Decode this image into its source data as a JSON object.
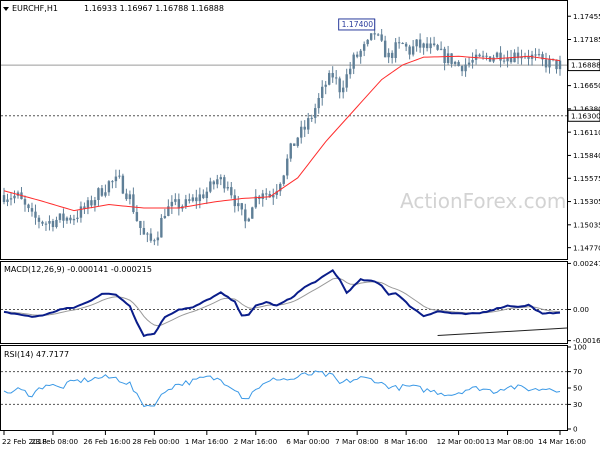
{
  "header": {
    "symbol": "EURCHF,H1",
    "ohlc": "1.16933 1.16967 1.16788 1.16888"
  },
  "watermark": "ActionForex.com",
  "colors": {
    "candle": "#5f7f97",
    "ma": "#ff2d2d",
    "macd": "#0a1d8a",
    "signal": "#9a9a9a",
    "rsi": "#3b99e6",
    "level": "#555555",
    "grid": "#c8c8c8",
    "frame": "#000000",
    "watermark": "#d3d3d3",
    "diverge": "#202020"
  },
  "chart_data": [
    {
      "id": "price",
      "type": "candlestick",
      "symbol": "EURCHF",
      "timeframe": "H1",
      "title": "EURCHF,H1  1.16933 1.16967 1.16788 1.16888",
      "ylim": [
        1.1465,
        1.1762
      ],
      "yticks": [
        "1.17455",
        "1.17185",
        "1.16915",
        "1.16650",
        "1.16380",
        "1.16110",
        "1.15840",
        "1.15575",
        "1.15305",
        "1.15035",
        "1.14770"
      ],
      "x_tick_labels": [
        "22 Feb 2018",
        "23 Feb 08:00",
        "26 Feb 16:00",
        "28 Feb 00:00",
        "1 Mar 16:00",
        "2 Mar 16:00",
        "6 Mar 00:00",
        "7 Mar 08:00",
        "8 Mar 16:00",
        "12 Mar 00:00",
        "13 Mar 08:00",
        "14 Mar 16:00"
      ],
      "x_tick_index": [
        0,
        14,
        29,
        43,
        58,
        72,
        87,
        101,
        115,
        130,
        144,
        159
      ],
      "close_label": "1.16888",
      "level_label": "1.16300",
      "level_value": 1.163,
      "peak_label": "1.17400",
      "peak_index": 106,
      "anchors": [
        [
          0,
          1.1538
        ],
        [
          4,
          1.1536
        ],
        [
          8,
          1.1512
        ],
        [
          12,
          1.1506
        ],
        [
          16,
          1.151
        ],
        [
          20,
          1.1513
        ],
        [
          24,
          1.1525
        ],
        [
          27,
          1.154
        ],
        [
          30,
          1.1552
        ],
        [
          33,
          1.1554
        ],
        [
          36,
          1.1535
        ],
        [
          38,
          1.151
        ],
        [
          40,
          1.149
        ],
        [
          42,
          1.1484
        ],
        [
          44,
          1.1496
        ],
        [
          46,
          1.152
        ],
        [
          49,
          1.1526
        ],
        [
          52,
          1.1527
        ],
        [
          55,
          1.1534
        ],
        [
          58,
          1.1542
        ],
        [
          61,
          1.1556
        ],
        [
          64,
          1.1552
        ],
        [
          67,
          1.1522
        ],
        [
          69,
          1.1506
        ],
        [
          71,
          1.153
        ],
        [
          74,
          1.1544
        ],
        [
          76,
          1.1537
        ],
        [
          78,
          1.1548
        ],
        [
          80,
          1.1566
        ],
        [
          82,
          1.159
        ],
        [
          84,
          1.1606
        ],
        [
          86,
          1.1615
        ],
        [
          88,
          1.163
        ],
        [
          90,
          1.1648
        ],
        [
          92,
          1.1667
        ],
        [
          94,
          1.1677
        ],
        [
          96,
          1.1662
        ],
        [
          98,
          1.1676
        ],
        [
          100,
          1.1695
        ],
        [
          102,
          1.1704
        ],
        [
          104,
          1.1712
        ],
        [
          106,
          1.1726
        ],
        [
          108,
          1.171
        ],
        [
          110,
          1.1698
        ],
        [
          112,
          1.1708
        ],
        [
          114,
          1.1712
        ],
        [
          116,
          1.1705
        ],
        [
          118,
          1.1712
        ],
        [
          120,
          1.1709
        ],
        [
          122,
          1.1708
        ],
        [
          124,
          1.1703
        ],
        [
          126,
          1.1698
        ],
        [
          128,
          1.1695
        ],
        [
          130,
          1.1688
        ],
        [
          132,
          1.169
        ],
        [
          134,
          1.1693
        ],
        [
          136,
          1.1694
        ],
        [
          138,
          1.1698
        ],
        [
          140,
          1.17
        ],
        [
          142,
          1.1702
        ],
        [
          144,
          1.1699
        ],
        [
          146,
          1.1701
        ],
        [
          148,
          1.1703
        ],
        [
          150,
          1.17
        ],
        [
          152,
          1.1696
        ],
        [
          154,
          1.1692
        ],
        [
          156,
          1.1691
        ],
        [
          158,
          1.1689
        ],
        [
          159,
          1.1689
        ]
      ],
      "ma_anchors": [
        [
          0,
          1.1543
        ],
        [
          10,
          1.1532
        ],
        [
          20,
          1.152
        ],
        [
          30,
          1.1527
        ],
        [
          40,
          1.1523
        ],
        [
          50,
          1.1523
        ],
        [
          60,
          1.153
        ],
        [
          68,
          1.1534
        ],
        [
          76,
          1.1536
        ],
        [
          84,
          1.1558
        ],
        [
          92,
          1.16
        ],
        [
          100,
          1.1636
        ],
        [
          108,
          1.1672
        ],
        [
          114,
          1.1689
        ],
        [
          120,
          1.1698
        ],
        [
          130,
          1.1699
        ],
        [
          140,
          1.1696
        ],
        [
          150,
          1.1699
        ],
        [
          159,
          1.1694
        ]
      ]
    },
    {
      "id": "macd",
      "type": "line",
      "title": "MACD(12,26,9) -0.000141 -0.000215",
      "series": [
        {
          "name": "MACD",
          "value": -0.000141
        },
        {
          "name": "Signal",
          "value": -0.000215
        }
      ],
      "ylim": [
        -0.00175,
        0.0025
      ],
      "tick_labels": [
        "0.002478",
        "0.00",
        "-0.001677"
      ],
      "tick_values": [
        0.002478,
        0.0,
        -0.001677
      ],
      "anchors": [
        [
          0,
          -0.00015
        ],
        [
          4,
          -0.00025
        ],
        [
          8,
          -0.0004
        ],
        [
          12,
          -0.00028
        ],
        [
          16,
          0.0
        ],
        [
          20,
          0.0001
        ],
        [
          24,
          0.0004
        ],
        [
          28,
          0.00085
        ],
        [
          32,
          0.0008
        ],
        [
          36,
          0.0002
        ],
        [
          38,
          -0.0007
        ],
        [
          40,
          -0.0014
        ],
        [
          43,
          -0.0013
        ],
        [
          46,
          -0.0004
        ],
        [
          50,
          0.0
        ],
        [
          54,
          0.0001
        ],
        [
          58,
          0.0005
        ],
        [
          62,
          0.0009
        ],
        [
          66,
          0.0004
        ],
        [
          68,
          -0.0003
        ],
        [
          70,
          -0.0003
        ],
        [
          72,
          0.0002
        ],
        [
          75,
          0.0004
        ],
        [
          78,
          0.0002
        ],
        [
          82,
          0.0006
        ],
        [
          86,
          0.0012
        ],
        [
          90,
          0.0016
        ],
        [
          94,
          0.0021
        ],
        [
          96,
          0.0016
        ],
        [
          98,
          0.0009
        ],
        [
          102,
          0.0016
        ],
        [
          106,
          0.0015
        ],
        [
          108,
          0.0013
        ],
        [
          110,
          0.0008
        ],
        [
          112,
          0.0009
        ],
        [
          116,
          0.0002
        ],
        [
          120,
          -0.00035
        ],
        [
          124,
          -0.0001
        ],
        [
          128,
          -0.0002
        ],
        [
          132,
          -0.00025
        ],
        [
          136,
          -0.0002
        ],
        [
          140,
          0.0
        ],
        [
          144,
          0.0002
        ],
        [
          148,
          0.00015
        ],
        [
          150,
          0.00025
        ],
        [
          154,
          -0.00025
        ],
        [
          159,
          -0.000141
        ]
      ],
      "diverge_line": [
        [
          124,
          -0.0014
        ],
        [
          159,
          -0.001
        ]
      ]
    },
    {
      "id": "rsi",
      "type": "line",
      "title": "RSI(14) 47.7177",
      "series": [
        {
          "name": "RSI",
          "value": 47.7177
        }
      ],
      "ylim": [
        0,
        100
      ],
      "tick_labels": [
        "100",
        "70",
        "50",
        "30",
        "0"
      ],
      "tick_values": [
        100,
        70,
        50,
        30,
        0
      ],
      "dashed_levels": [
        70,
        30
      ],
      "anchors": [
        [
          0,
          43
        ],
        [
          4,
          48
        ],
        [
          8,
          42
        ],
        [
          12,
          55
        ],
        [
          16,
          50
        ],
        [
          20,
          58
        ],
        [
          24,
          60
        ],
        [
          28,
          63
        ],
        [
          32,
          62
        ],
        [
          36,
          55
        ],
        [
          38,
          40
        ],
        [
          40,
          30
        ],
        [
          42,
          28
        ],
        [
          44,
          35
        ],
        [
          47,
          50
        ],
        [
          50,
          55
        ],
        [
          54,
          58
        ],
        [
          58,
          63
        ],
        [
          62,
          60
        ],
        [
          66,
          50
        ],
        [
          68,
          40
        ],
        [
          70,
          38
        ],
        [
          72,
          50
        ],
        [
          75,
          55
        ],
        [
          78,
          62
        ],
        [
          82,
          60
        ],
        [
          86,
          66
        ],
        [
          90,
          68
        ],
        [
          94,
          64
        ],
        [
          96,
          55
        ],
        [
          98,
          58
        ],
        [
          102,
          62
        ],
        [
          106,
          60
        ],
        [
          108,
          55
        ],
        [
          112,
          50
        ],
        [
          116,
          52
        ],
        [
          120,
          48
        ],
        [
          124,
          45
        ],
        [
          128,
          42
        ],
        [
          132,
          48
        ],
        [
          136,
          50
        ],
        [
          140,
          46
        ],
        [
          144,
          52
        ],
        [
          148,
          50
        ],
        [
          152,
          48
        ],
        [
          156,
          50
        ],
        [
          159,
          47.7
        ]
      ]
    }
  ]
}
